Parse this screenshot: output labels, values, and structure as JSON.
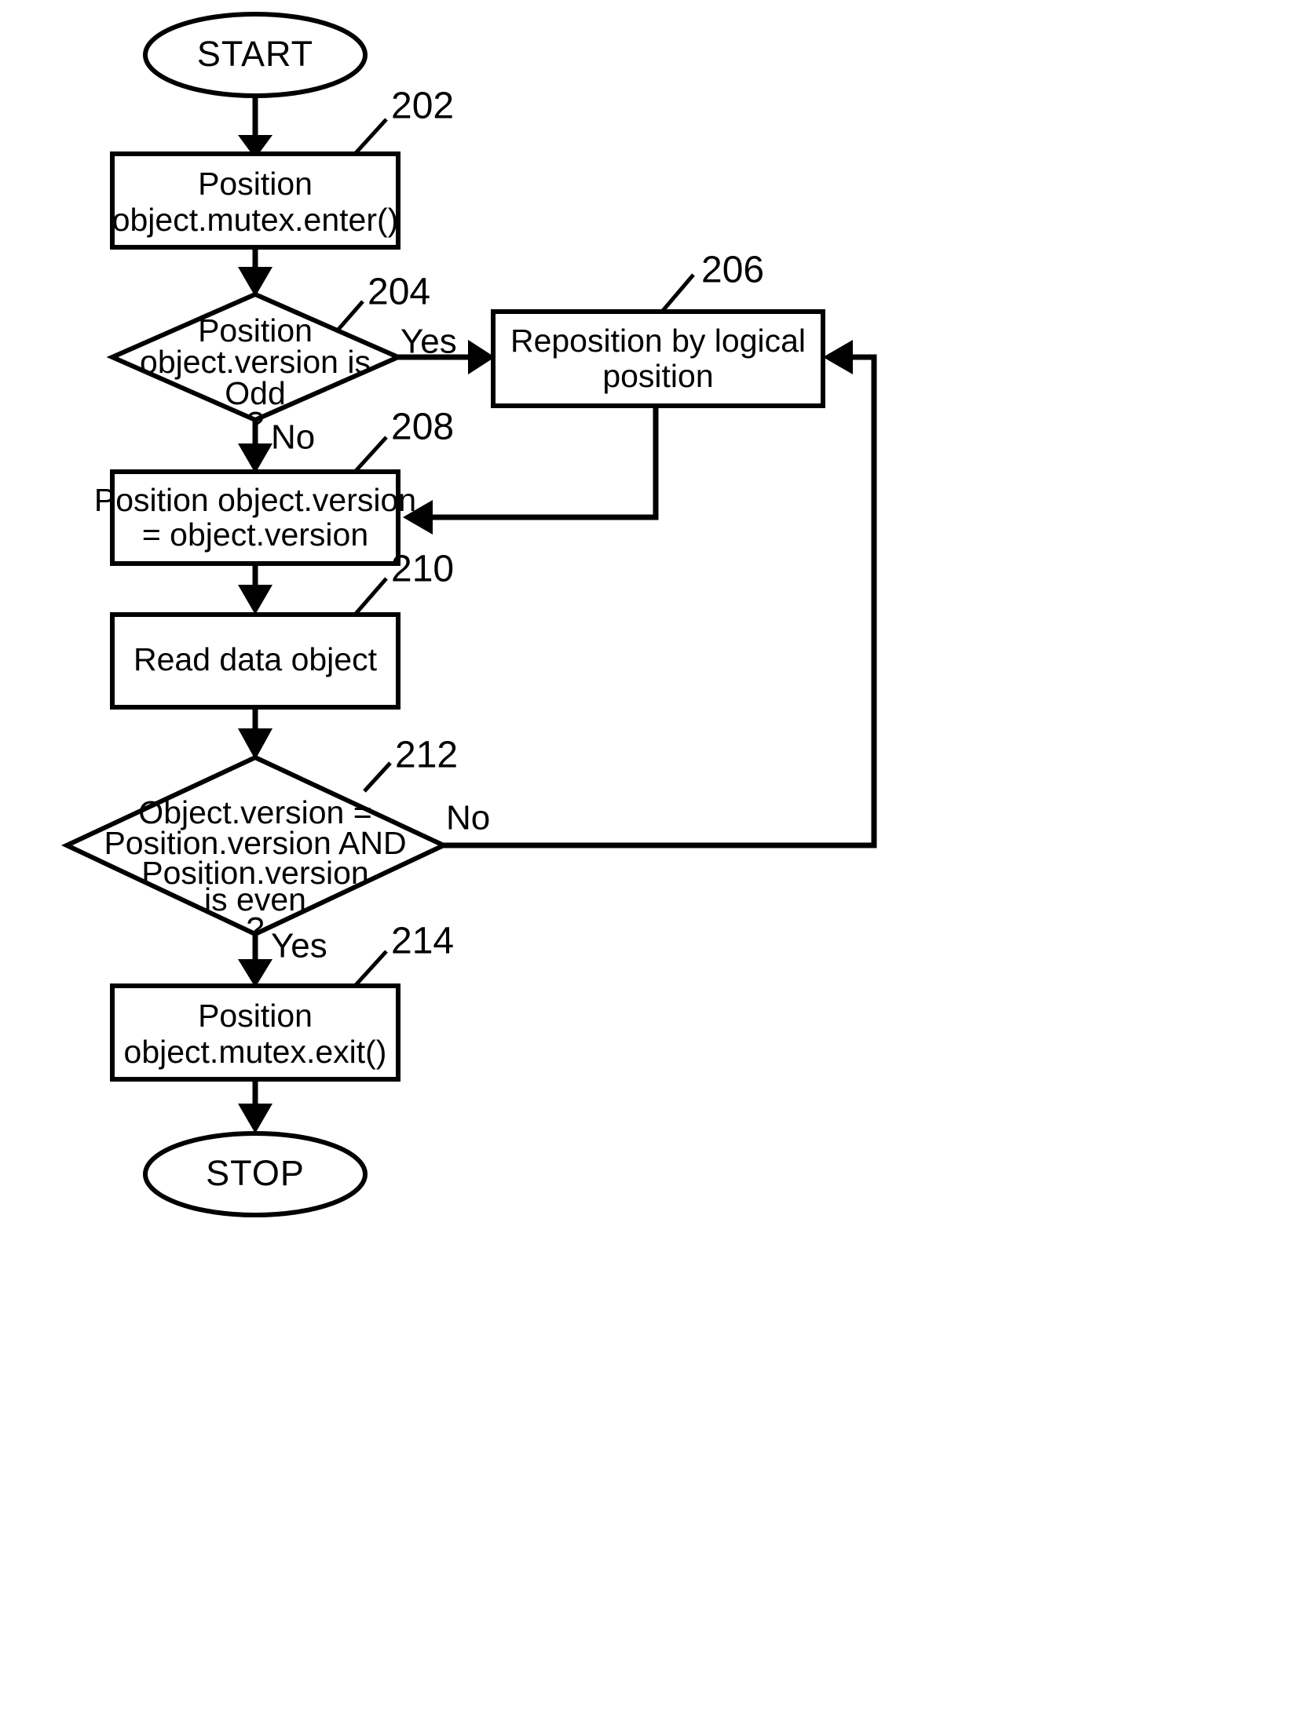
{
  "diagram": {
    "kind": "flowchart",
    "title": "",
    "background_color": "#ffffff",
    "line_color": "#000000"
  },
  "nodes": {
    "start": {
      "ref": "",
      "shape": "terminator",
      "label": "START"
    },
    "n202": {
      "ref": "202",
      "shape": "process",
      "line1": "Position",
      "line2": "object.mutex.enter()"
    },
    "n204": {
      "ref": "204",
      "shape": "decision",
      "line1": "Position",
      "line2": "object.version is",
      "line3": "Odd",
      "line4": "?"
    },
    "n206": {
      "ref": "206",
      "shape": "process",
      "line1": "Reposition by logical",
      "line2": "position"
    },
    "n208": {
      "ref": "208",
      "shape": "process",
      "line1": "Position object.version",
      "line2": "= object.version"
    },
    "n210": {
      "ref": "210",
      "shape": "process",
      "line1": "Read data object"
    },
    "n212": {
      "ref": "212",
      "shape": "decision",
      "line1": "Object.version =",
      "line2": "Position.version AND",
      "line3": "Position.version",
      "line4": "is even",
      "line5": "?"
    },
    "n214": {
      "ref": "214",
      "shape": "process",
      "line1": "Position",
      "line2": "object.mutex.exit()"
    },
    "stop": {
      "ref": "",
      "shape": "terminator",
      "label": "STOP"
    }
  },
  "edges": {
    "start_to_202": {
      "label": ""
    },
    "e202_to_204": {
      "label": ""
    },
    "e204_yes": {
      "label": "Yes"
    },
    "e204_no": {
      "label": "No"
    },
    "e206_to_208": {
      "label": ""
    },
    "e208_to_210": {
      "label": ""
    },
    "e210_to_212": {
      "label": ""
    },
    "e212_no": {
      "label": "No"
    },
    "e212_yes": {
      "label": "Yes"
    },
    "e214_to_stop": {
      "label": ""
    }
  }
}
